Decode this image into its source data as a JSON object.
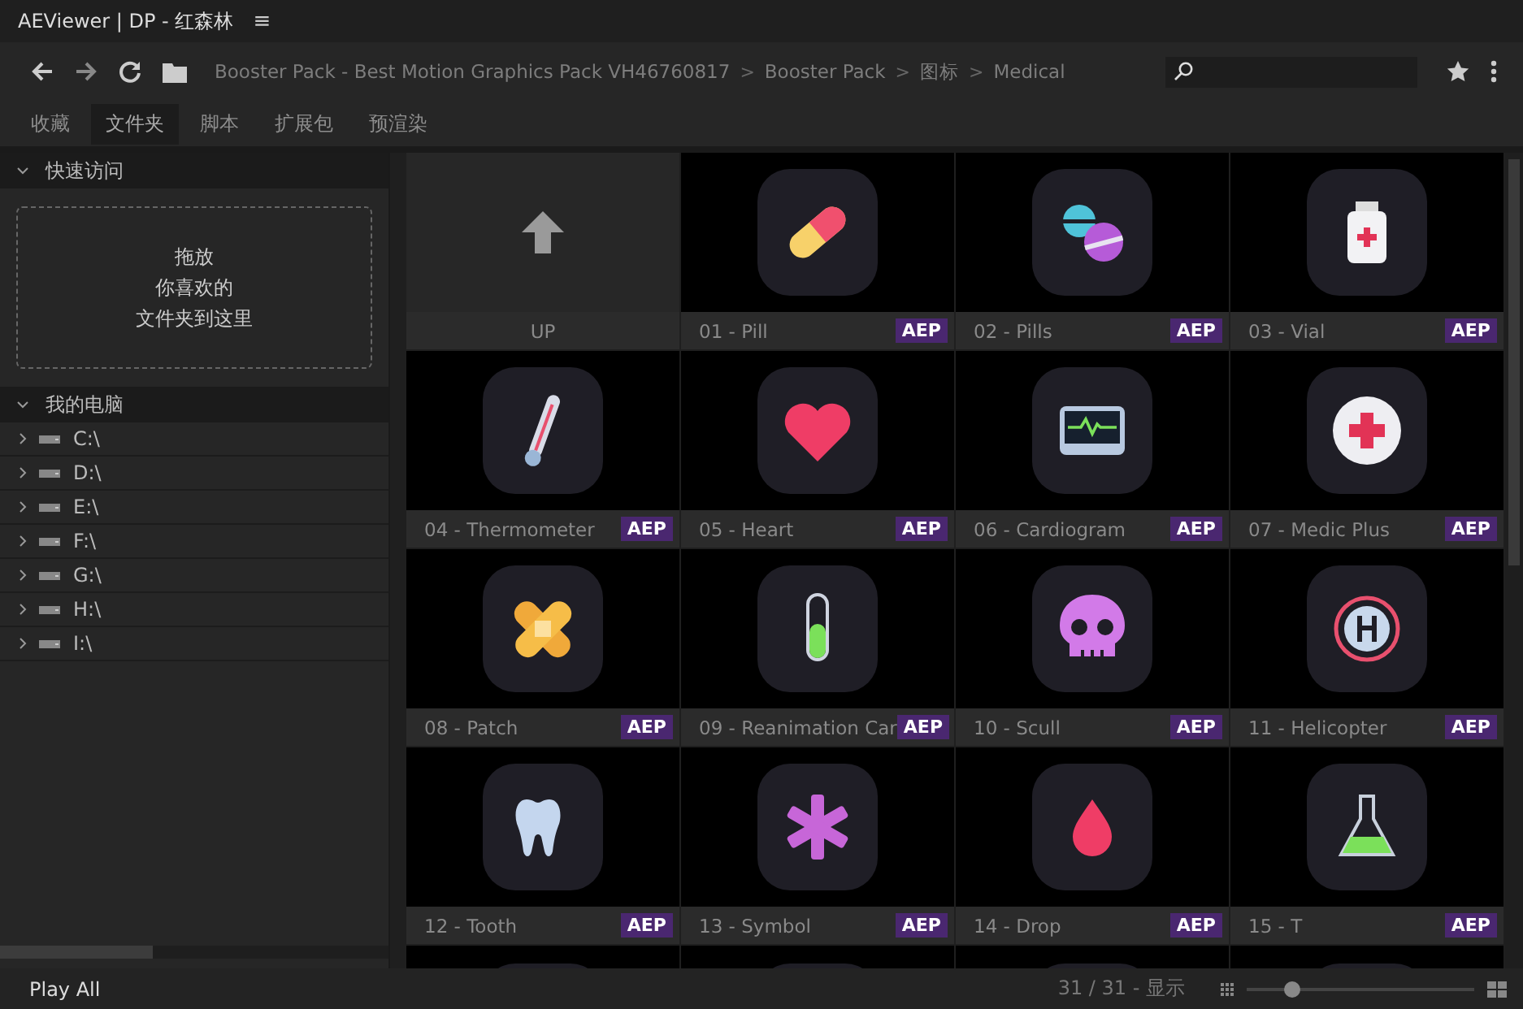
{
  "window": {
    "title": "AEViewer | DP - 红森林",
    "menu_glyph": "≡"
  },
  "breadcrumb": [
    "Booster Pack - Best Motion Graphics Pack VH46760817",
    "Booster Pack",
    "图标",
    "Medical"
  ],
  "breadcrumb_separator": ">",
  "tabs": [
    {
      "label": "收藏",
      "selected": false
    },
    {
      "label": "文件夹",
      "selected": true
    },
    {
      "label": "脚本",
      "selected": false
    },
    {
      "label": "扩展包",
      "selected": false
    },
    {
      "label": "预渲染",
      "selected": false
    }
  ],
  "sidebar": {
    "quick_access": {
      "title": "快速访问",
      "expanded": true,
      "drop_hint": [
        "拖放",
        "你喜欢的",
        "文件夹到这里"
      ]
    },
    "computer": {
      "title": "我的电脑",
      "expanded": true,
      "drives": [
        {
          "label": "C:\\",
          "expanded": false
        },
        {
          "label": "D:\\",
          "expanded": false
        },
        {
          "label": "E:\\",
          "expanded": false
        },
        {
          "label": "F:\\",
          "expanded": false
        },
        {
          "label": "G:\\",
          "expanded": false
        },
        {
          "label": "H:\\",
          "expanded": false
        },
        {
          "label": "I:\\",
          "expanded": false
        }
      ]
    }
  },
  "grid": {
    "up_label": "UP",
    "tiles": [
      {
        "name": "01 - Pill",
        "badge": "AEP"
      },
      {
        "name": "02 - Pills",
        "badge": "AEP"
      },
      {
        "name": "03 - Vial",
        "badge": "AEP"
      },
      {
        "name": "04 - Thermometer",
        "badge": "AEP"
      },
      {
        "name": "05 - Heart",
        "badge": "AEP"
      },
      {
        "name": "06 - Cardiogram",
        "badge": "AEP"
      },
      {
        "name": "07 - Medic Plus",
        "badge": "AEP"
      },
      {
        "name": "08 - Patch",
        "badge": "AEP"
      },
      {
        "name": "09 - Reanimation Car",
        "badge": "AEP"
      },
      {
        "name": "10 - Scull",
        "badge": "AEP"
      },
      {
        "name": "11 - Helicopter",
        "badge": "AEP"
      },
      {
        "name": "12 - Tooth",
        "badge": "AEP"
      },
      {
        "name": "13 - Symbol",
        "badge": "AEP"
      },
      {
        "name": "14 - Drop",
        "badge": "AEP"
      },
      {
        "name": "15 - T",
        "badge": "AEP"
      }
    ]
  },
  "status_bar": {
    "play_all": "Play All",
    "count": "31 / 31 - 显示",
    "zoom": {
      "level": 0.2
    }
  }
}
